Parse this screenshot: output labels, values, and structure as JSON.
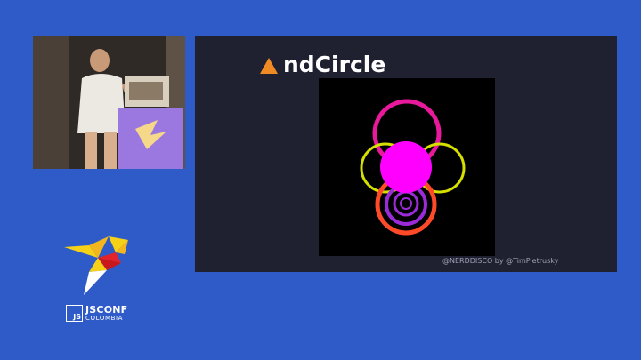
{
  "slide": {
    "title": "ndCircle",
    "title_icon": "triangle-icon",
    "credit": "@NERDDISCO by @TimPietrusky"
  },
  "speaker_video": {
    "description_icon": "speaker-video-feed"
  },
  "logo": {
    "box_text": "JS",
    "main_text": "JSCONF",
    "sub_text": "COLOMBIA"
  },
  "colors": {
    "background": "#2e5bc8",
    "slide_bg": "#1f2130",
    "magenta": "#ff00ff",
    "pink_ring": "#e8199a",
    "yellow_ring": "#d6e000",
    "orange_ring": "#ff4a2a",
    "purple_ring": "#9b2ad8",
    "triangle": "#f08a24"
  }
}
